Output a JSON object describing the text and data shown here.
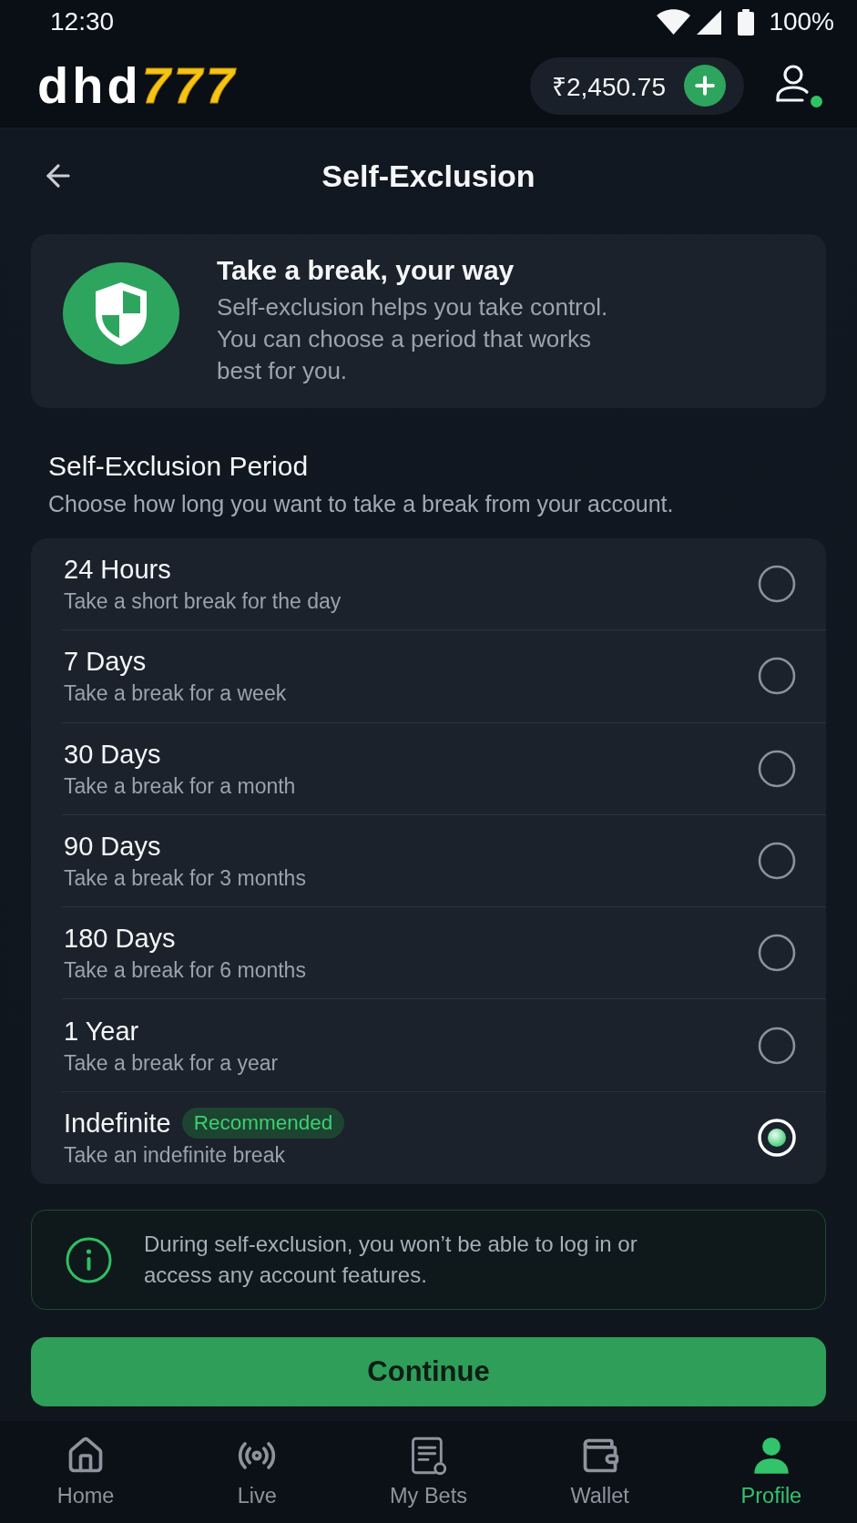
{
  "status_bar": {
    "time": "12:30",
    "battery": "100%"
  },
  "header": {
    "logo": {
      "text": "dhd",
      "accent": "777"
    },
    "balance": "₹2,450.75"
  },
  "page": {
    "title": "Self-Exclusion"
  },
  "intro": {
    "title": "Take a break, your way",
    "text": "Self-exclusion helps you take control. You can choose a period that works best for you."
  },
  "period": {
    "heading": "Self-Exclusion Period",
    "subheading": "Choose how long you want to take a break from your account."
  },
  "options": [
    {
      "label": "24 Hours",
      "description": "Take a short break for the day",
      "selected": false
    },
    {
      "label": "7 Days",
      "description": "Take a break for a week",
      "selected": false
    },
    {
      "label": "30 Days",
      "description": "Take a break for a month",
      "selected": false
    },
    {
      "label": "90 Days",
      "description": "Take a break for 3 months",
      "selected": false
    },
    {
      "label": "180 Days",
      "description": "Take a break for 6 months",
      "selected": false
    },
    {
      "label": "1 Year",
      "description": "Take a break for a year",
      "selected": false
    },
    {
      "label": "Indefinite",
      "badge": "Recommended",
      "description": "Take an indefinite break",
      "selected": true
    }
  ],
  "notice": {
    "text": "During self-exclusion, you won’t be able to log in or access any account features."
  },
  "continue_button": {
    "label": "Continue"
  },
  "nav": [
    {
      "label": "Home",
      "kind": "home",
      "selected": false
    },
    {
      "label": "Live",
      "kind": "live",
      "selected": false
    },
    {
      "label": "My Bets",
      "kind": "bets",
      "selected": false
    },
    {
      "label": "Wallet",
      "kind": "wallet",
      "selected": false
    },
    {
      "label": "Profile",
      "kind": "profile",
      "selected": true
    }
  ]
}
